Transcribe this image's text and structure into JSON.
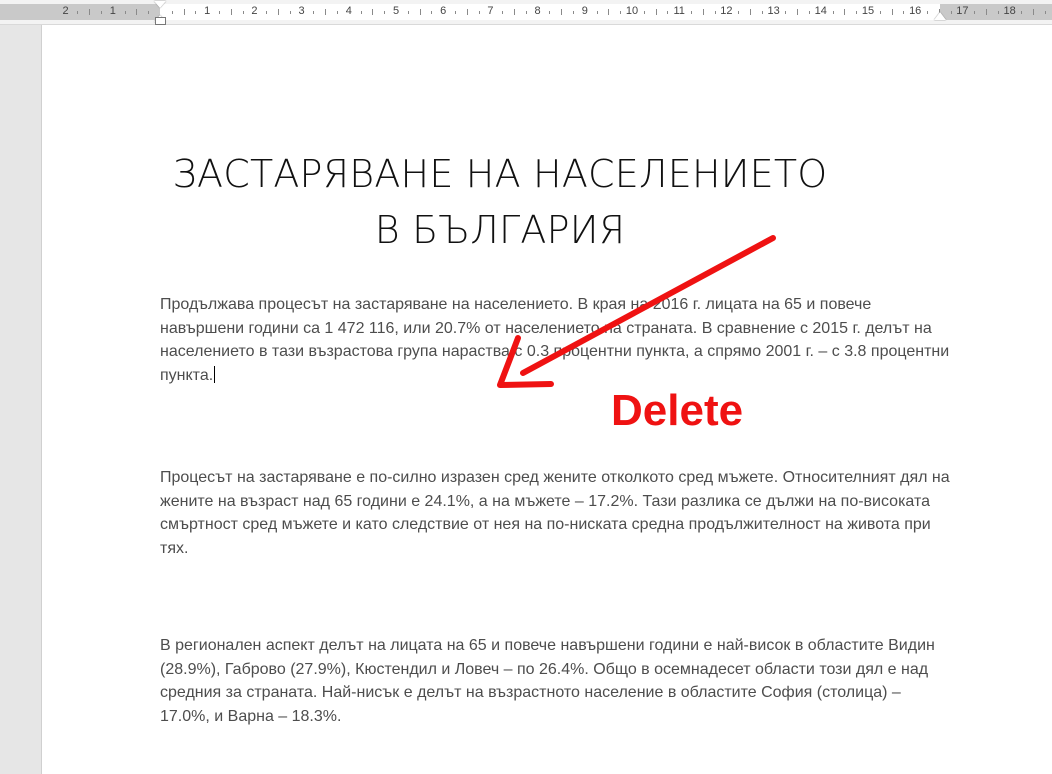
{
  "ruler": {
    "numbers": [
      "2",
      "1",
      "",
      "1",
      "2",
      "3",
      "4",
      "5",
      "6",
      "7",
      "8",
      "9",
      "10",
      "11",
      "12",
      "13",
      "14",
      "15",
      "16",
      "17",
      "18"
    ]
  },
  "document": {
    "title": "ЗАСТАРЯВАНЕ НА НАСЕЛЕНИЕТО В БЪЛГАРИЯ",
    "paragraphs": [
      "Продължава процесът на застаряване на населението. В края на 2016 г. лицата на 65 и повече навършени години са 1 472 116, или 20.7% от населението на страната. В сравнение с 2015 г. делът на населението в тази възрастова група нараства с 0.3 процентни пункта, а спрямо 2001 г. – с 3.8 процентни пункта.",
      "Процесът на застаряване е по-силно изразен сред жените отколкото сред мъжете. Относителният дял на жените на възраст над 65 години е 24.1%, а на мъжете – 17.2%. Тази разлика се дължи на по-високата смъртност сред мъжете и като следствие от нея на по-ниската средна продължителност на живота при тях.",
      "В регионален аспект делът на лицата на 65 и повече навършени години е най-висок в областите Видин (28.9%), Габрово (27.9%), Кюстендил и Ловеч – по 26.4%. Общо в осемнадесет области този дял е над средния за страната. Най-нисък е делът на възрастното население в областите София (столица) – 17.0%, и Варна – 18.3%."
    ]
  },
  "annotation": {
    "label": "Delete",
    "color": "#ef1212",
    "icon": "arrow-icon"
  }
}
